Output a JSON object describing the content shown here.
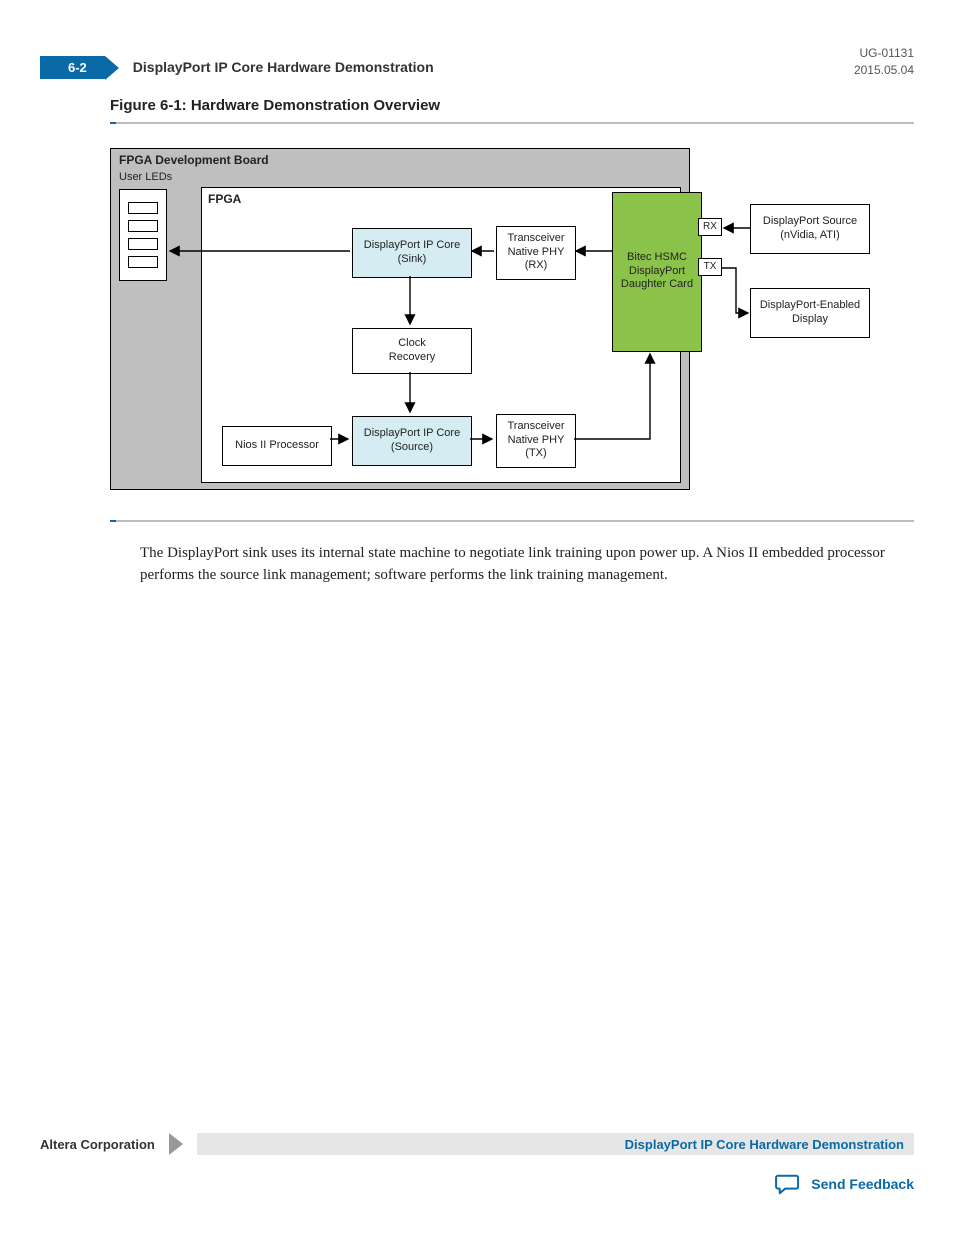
{
  "header": {
    "page_number": "6-2",
    "title": "DisplayPort IP Core Hardware Demonstration",
    "doc_id": "UG-01131",
    "doc_date": "2015.05.04"
  },
  "figure": {
    "caption": "Figure 6-1: Hardware Demonstration Overview",
    "board_label": "FPGA Development Board",
    "user_leds_label": "User LEDs",
    "fpga_label": "FPGA",
    "blocks": {
      "sink": {
        "l1": "DisplayPort IP Core",
        "l2": "(Sink)"
      },
      "rx_phy": {
        "l1": "Transceiver",
        "l2": "Native PHY",
        "l3": "(RX)"
      },
      "clock": {
        "l1": "Clock",
        "l2": "Recovery"
      },
      "nios": {
        "l1": "Nios II Processor"
      },
      "source": {
        "l1": "DisplayPort IP Core",
        "l2": "(Source)"
      },
      "tx_phy": {
        "l1": "Transceiver",
        "l2": "Native PHY",
        "l3": "(TX)"
      },
      "daughter": {
        "l1": "Bitec HSMC",
        "l2": "DisplayPort",
        "l3": "Daughter Card"
      },
      "rx_port": "RX",
      "tx_port": "TX",
      "ext_src": {
        "l1": "DisplayPort Source",
        "l2": "(nVidia, ATI)"
      },
      "ext_disp": {
        "l1": "DisplayPort-Enabled",
        "l2": "Display"
      }
    }
  },
  "body_paragraph": "The DisplayPort sink uses its internal state machine to negotiate link training upon power up. A Nios II embedded processor performs the source link management; software performs the link training management.",
  "footer": {
    "corp": "Altera Corporation",
    "chapter": "DisplayPort IP Core Hardware Demonstration",
    "feedback": "Send Feedback"
  }
}
